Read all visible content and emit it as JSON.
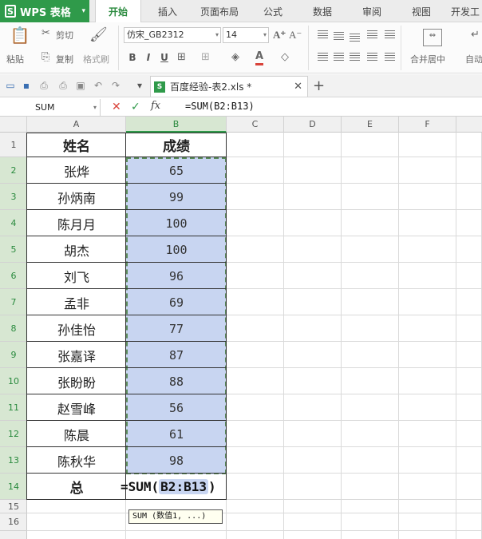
{
  "app": {
    "name": "WPS 表格"
  },
  "tabs": [
    "开始",
    "插入",
    "页面布局",
    "公式",
    "数据",
    "审阅",
    "视图",
    "开发工"
  ],
  "active_tab": "开始",
  "ribbon": {
    "paste": "粘贴",
    "cut": "剪切",
    "copy": "复制",
    "format_painter": "格式刷",
    "font_name": "仿宋_GB2312",
    "font_size": "14",
    "bold": "B",
    "italic": "I",
    "underline": "U",
    "merge": "合并居中",
    "autowrap": "自动"
  },
  "document": {
    "tab_title": "百度经验-表2.xls *"
  },
  "formula_bar": {
    "name_box": "SUM",
    "fx": "fx",
    "content": "=SUM(B2:B13)"
  },
  "columns": [
    "A",
    "B",
    "C",
    "D",
    "E",
    "F"
  ],
  "rows": [
    "1",
    "2",
    "3",
    "4",
    "5",
    "6",
    "7",
    "8",
    "9",
    "10",
    "11",
    "12",
    "13",
    "14",
    "15",
    "16"
  ],
  "table": {
    "headers": [
      "姓名",
      "成绩"
    ],
    "records": [
      {
        "name": "张烨",
        "score": "65"
      },
      {
        "name": "孙炳南",
        "score": "99"
      },
      {
        "name": "陈月月",
        "score": "100"
      },
      {
        "name": "胡杰",
        "score": "100"
      },
      {
        "name": "刘飞",
        "score": "96"
      },
      {
        "name": "孟非",
        "score": "69"
      },
      {
        "name": "孙佳怡",
        "score": "77"
      },
      {
        "name": "张嘉译",
        "score": "87"
      },
      {
        "name": "张盼盼",
        "score": "88"
      },
      {
        "name": "赵雪峰",
        "score": "56"
      },
      {
        "name": "陈晨",
        "score": "61"
      },
      {
        "name": "陈秋华",
        "score": "98"
      }
    ],
    "total_label": "总"
  },
  "cell_editing": {
    "prefix": "=SUM(",
    "ref": "B2:B13",
    "suffix": ")"
  },
  "tooltip": "SUM (数值1, ...)",
  "colors": {
    "brand": "#2f9a4a",
    "selection": "#c8d5f1"
  }
}
